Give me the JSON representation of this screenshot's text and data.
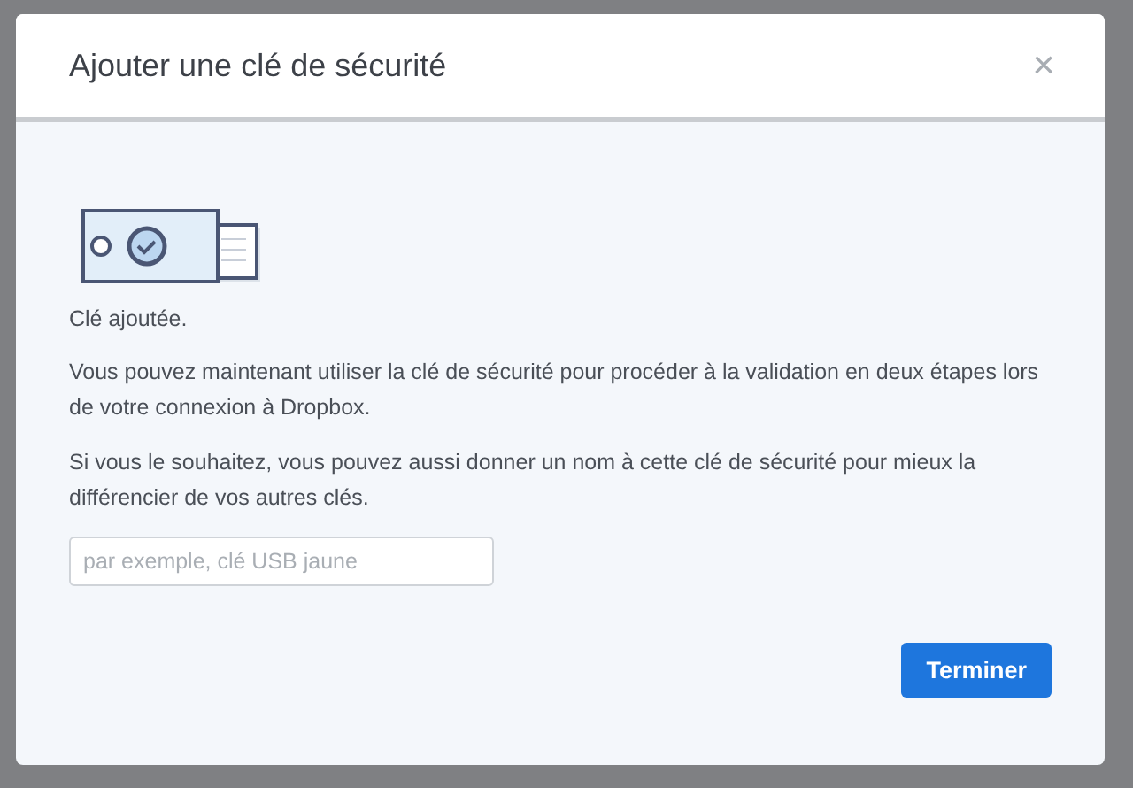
{
  "dialog": {
    "title": "Ajouter une clé de sécurité",
    "close": "×",
    "status": "Clé ajoutée.",
    "paragraphs": [
      "Vous pouvez maintenant utiliser la clé de sécurité pour procéder à la validation en deux étapes lors de votre connexion à Dropbox.",
      "Si vous le souhaitez, vous pouvez aussi donner un nom à cette clé de sécurité pour mieux la différencier de vos autres clés."
    ],
    "name_field": {
      "placeholder": "par exemple, clé USB jaune"
    },
    "buttons": [
      "Terminer"
    ]
  }
}
